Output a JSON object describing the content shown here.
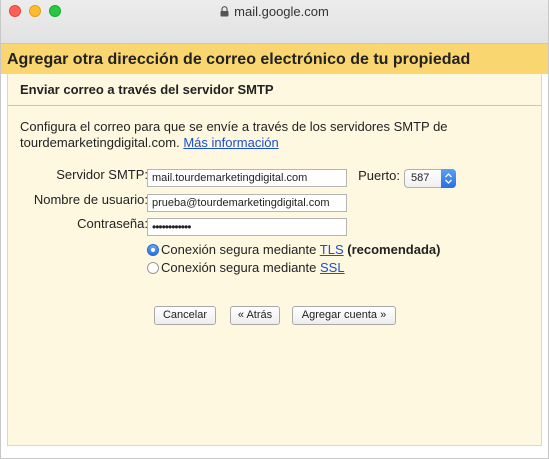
{
  "window": {
    "url": "mail.google.com",
    "colors": {
      "header_bg": "#f9d66f",
      "panel_bg": "#fff8e1",
      "link": "#1a4fd0",
      "radio_selected": "#2b6fe2"
    }
  },
  "header": {
    "title": "Agregar otra dirección de correo electrónico de tu propiedad"
  },
  "section": {
    "title": "Enviar correo a través del servidor SMTP",
    "intro_text": "Configura el correo para que se envíe a través de los servidores SMTP de tourdemarketingdigital.com.",
    "more_info_link": "Más información"
  },
  "form": {
    "smtp_label": "Servidor SMTP:",
    "smtp_value": "mail.tourdemarketingdigital.com",
    "port_label": "Puerto:",
    "port_value": "587",
    "username_label": "Nombre de usuario:",
    "username_value": "prueba@tourdemarketingdigital.com",
    "password_label": "Contraseña:",
    "password_mask": "••••••••••••"
  },
  "connection": {
    "tls_prefix": "Conexión segura mediante",
    "tls_link": "TLS",
    "tls_suffix": "(recomendada)",
    "ssl_prefix": "Conexión segura mediante",
    "ssl_link": "SSL",
    "selected": "TLS"
  },
  "buttons": {
    "cancel": "Cancelar",
    "back": "« Atrás",
    "add_account": "Agregar cuenta »"
  }
}
